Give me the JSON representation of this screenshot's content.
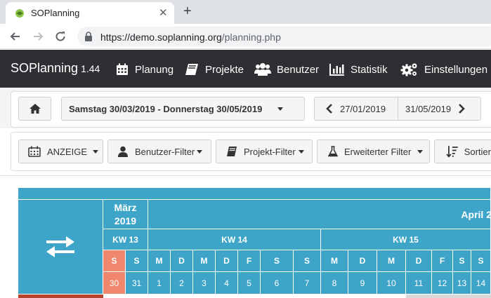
{
  "browser": {
    "tab_title": "SOPlanning",
    "url_host": "https://demo.soplanning.org",
    "url_path": "/planning.php"
  },
  "navbar": {
    "brand": "SOPlanning",
    "version": "1.44",
    "items": [
      {
        "label": "Planung",
        "icon": "calendar-icon"
      },
      {
        "label": "Projekte",
        "icon": "book-icon"
      },
      {
        "label": "Benutzer",
        "icon": "users-icon"
      },
      {
        "label": "Statistik",
        "icon": "bar-chart-icon"
      },
      {
        "label": "Einstellungen",
        "icon": "gears-icon"
      }
    ]
  },
  "toolbar": {
    "date_range": "Samstag 30/03/2019 - Donnerstag 30/05/2019",
    "prev_date": "27/01/2019",
    "next_date": "31/05/2019"
  },
  "filters": {
    "anzeige": "ANZEIGE",
    "user_filter": "Benutzer-Filter",
    "project_filter": "Projekt-Filter",
    "advanced_filter": "Erweiterter Filter",
    "sort": "Sortier"
  },
  "planning": {
    "month_1": "März 2019",
    "month_2": "April 2",
    "weeks": [
      "KW 13",
      "KW 14",
      "KW 15"
    ],
    "days": [
      {
        "letter": "S",
        "num": "30",
        "today": true
      },
      {
        "letter": "S",
        "num": "31"
      },
      {
        "letter": "M",
        "num": "1"
      },
      {
        "letter": "D",
        "num": "2"
      },
      {
        "letter": "M",
        "num": "3"
      },
      {
        "letter": "D",
        "num": "4"
      },
      {
        "letter": "F",
        "num": "5"
      },
      {
        "letter": "S",
        "num": "6"
      },
      {
        "letter": "S",
        "num": "7"
      },
      {
        "letter": "M",
        "num": "8"
      },
      {
        "letter": "D",
        "num": "9"
      },
      {
        "letter": "M",
        "num": "10"
      },
      {
        "letter": "D",
        "num": "11"
      },
      {
        "letter": "F",
        "num": "12"
      },
      {
        "letter": "S",
        "num": "13"
      },
      {
        "letter": "S",
        "num": "14"
      }
    ]
  },
  "colors": {
    "grid_blue": "#3ea5c8",
    "today_orange": "#f0866b",
    "navbar": "#2e2f33"
  }
}
